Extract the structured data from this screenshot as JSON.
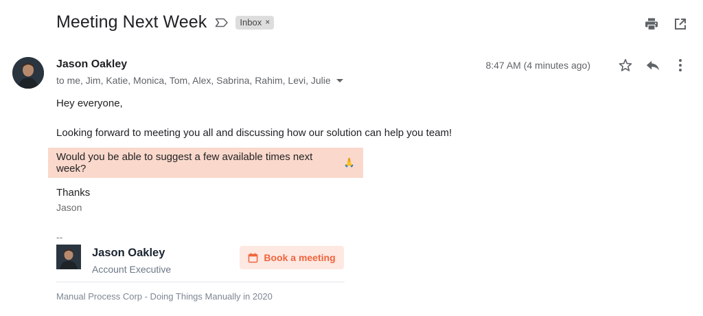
{
  "email": {
    "subject": "Meeting Next Week",
    "label_chip": "Inbox",
    "label_chip_close": "×",
    "sender_name": "Jason Oakley",
    "recipients": "to me, Jim, Katie, Monica, Tom, Alex, Sabrina, Rahim, Levi, Julie",
    "timestamp": "8:47 AM (4 minutes ago)",
    "body": {
      "greeting": "Hey everyone,",
      "paragraph": "Looking forward to meeting you all and discussing how our solution can help you team!",
      "highlight": "Would you be able to suggest a few available times next week?",
      "emoji": "🙏",
      "closing": "Thanks",
      "signoff": "Jason"
    }
  },
  "signature": {
    "dash": "--",
    "name": "Jason Oakley",
    "title": "Account Executive",
    "cta_label": "Book a meeting",
    "company": "Manual Process Corp - Doing Things Manually in 2020"
  },
  "icons": {
    "label": "label-outline-icon",
    "print": "print-icon",
    "open_new": "open-in-new-window-icon",
    "star": "star-outline-icon",
    "reply": "reply-icon",
    "more": "more-vert-icon",
    "calendar": "calendar-icon"
  },
  "colors": {
    "highlight_bg": "#fad8cc",
    "cta_bg": "#fde8e2",
    "cta_text": "#f0643c",
    "chip_bg": "#dddddd"
  }
}
